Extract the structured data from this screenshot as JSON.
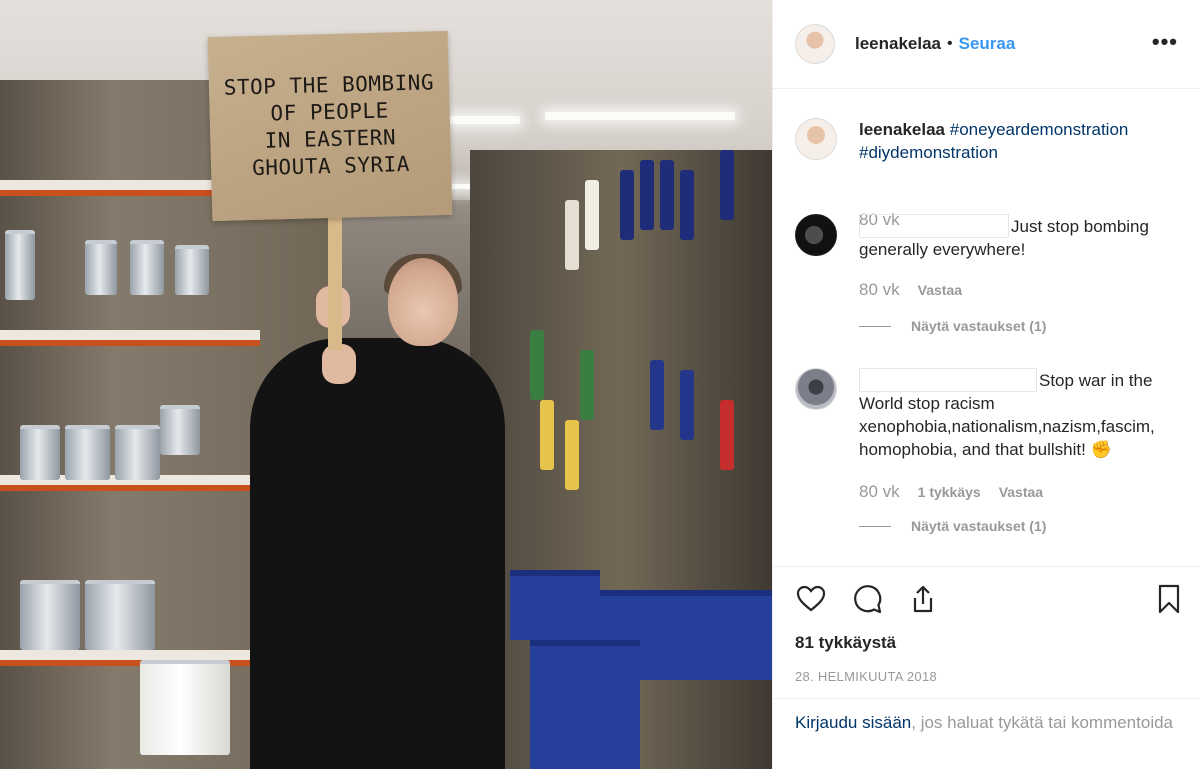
{
  "sign": {
    "text": "STOP THE BOMBING\nOF PEOPLE\nIN EASTERN\nGHOUTA SYRIA"
  },
  "header": {
    "username": "leenakelaa",
    "separator": "•",
    "follow_label": "Seuraa",
    "more_label": "•••"
  },
  "caption": {
    "username": "leenakelaa",
    "hashtags": [
      "#oneyeardemonstration",
      "#diydemonstration"
    ],
    "time": "80 vk"
  },
  "comments": [
    {
      "text": "Just stop bombing generally everywhere!",
      "time": "80 vk",
      "likes": "",
      "reply_label": "Vastaa",
      "view_replies": "Näytä vastaukset (1)"
    },
    {
      "text": "Stop war in the World stop racism xenophobia,nationalism,nazism,fascim, homophobia, and that bullshit! ✊",
      "time": "80 vk",
      "likes": "1 tykkäys",
      "reply_label": "Vastaa",
      "view_replies": "Näytä vastaukset (1)"
    }
  ],
  "actions": {
    "like_icon": "heart-icon",
    "comment_icon": "comment-icon",
    "share_icon": "share-icon",
    "save_icon": "bookmark-icon"
  },
  "likes_count": "81 tykkäystä",
  "post_date": "28. HELMIKUUTA 2018",
  "login": {
    "link": "Kirjaudu sisään",
    "rest": ", jos haluat tykätä tai kommentoida"
  }
}
